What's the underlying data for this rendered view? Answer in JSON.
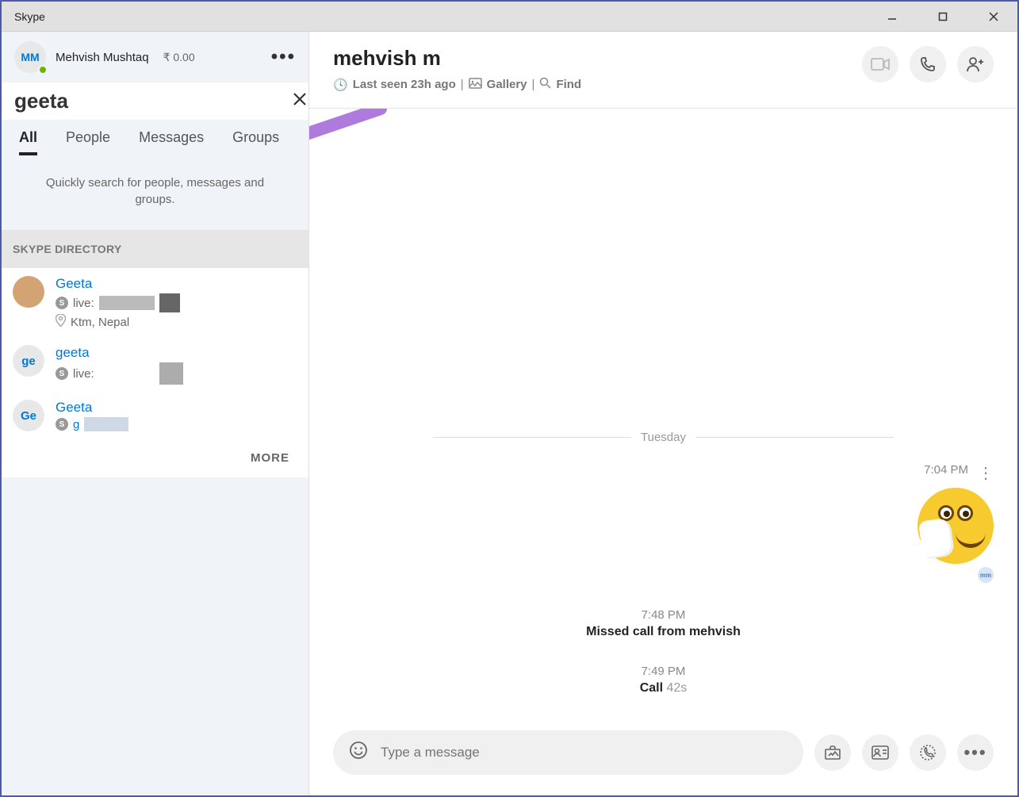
{
  "app": {
    "title": "Skype"
  },
  "profile": {
    "initials": "MM",
    "name": "Mehvish Mushtaq",
    "credit": "₹ 0.00"
  },
  "search": {
    "value": "geeta",
    "tabs": [
      "All",
      "People",
      "Messages",
      "Groups"
    ],
    "active_tab": "All",
    "hint": "Quickly search for people, messages and groups."
  },
  "directory": {
    "header": "SKYPE DIRECTORY",
    "results": [
      {
        "name": "Geeta",
        "live_prefix": "live:",
        "location": "Ktm, Nepal",
        "avatar_type": "photo"
      },
      {
        "name": "geeta",
        "live_prefix": "live:",
        "avatar_text": "ge"
      },
      {
        "name": "Geeta",
        "avatar_text": "Ge",
        "prefix_letter": "g"
      }
    ],
    "more_label": "MORE"
  },
  "chat": {
    "contact_name": "mehvish m",
    "last_seen": "Last seen 23h ago",
    "gallery_label": "Gallery",
    "find_label": "Find",
    "date_label": "Tuesday",
    "messages": {
      "emoji_time": "7:04 PM",
      "missed_call": {
        "time": "7:48 PM",
        "text": "Missed call from mehvish"
      },
      "call": {
        "time": "7:49 PM",
        "label": "Call",
        "duration": "42s"
      }
    },
    "composer": {
      "placeholder": "Type a message"
    },
    "small_avatar": "mm"
  }
}
